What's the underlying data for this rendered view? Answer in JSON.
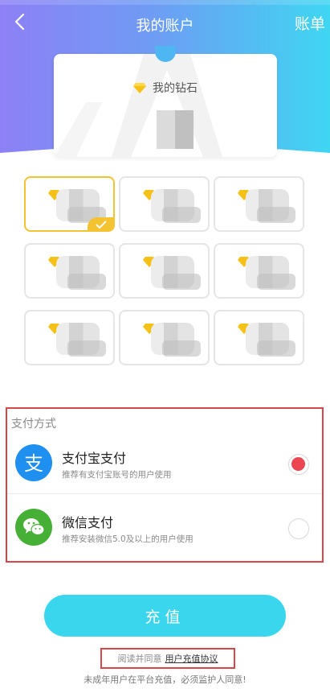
{
  "header": {
    "title": "我的账户",
    "bill_label": "账单",
    "gradient_start": "#8d80f6",
    "gradient_end": "#3fd6f2"
  },
  "diamond_card": {
    "label": "我的钻石",
    "icon": "diamond-icon",
    "amount": ""
  },
  "packages": {
    "selected_index": 0,
    "items": [
      {
        "amount": "",
        "price": ""
      },
      {
        "amount": "",
        "price": ""
      },
      {
        "amount": "",
        "price": ""
      },
      {
        "amount": "",
        "price": ""
      },
      {
        "amount": "",
        "price": ""
      },
      {
        "amount": "",
        "price": ""
      },
      {
        "amount": "",
        "price": ""
      },
      {
        "amount": "",
        "price": ""
      },
      {
        "amount": "",
        "price": ""
      }
    ]
  },
  "payment": {
    "heading": "支付方式",
    "methods": [
      {
        "name": "支付宝支付",
        "desc": "推荐有支付宝账号的用户使用",
        "icon": "alipay-icon",
        "selected": true
      },
      {
        "name": "微信支付",
        "desc": "推荐安装微信5.0及以上的用户使用",
        "icon": "wechat-icon",
        "selected": false
      }
    ]
  },
  "recharge_button": "充值",
  "agreement": {
    "prefix": "阅读并同意",
    "link": "用户充值协议"
  },
  "minor_notice": "未成年用户在平台充值，必须监护人同意!",
  "colors": {
    "accent": "#3ad6ed",
    "selected_border": "#f3c331",
    "radio_checked": "#ec4653",
    "highlight_box": "#d9464a"
  }
}
